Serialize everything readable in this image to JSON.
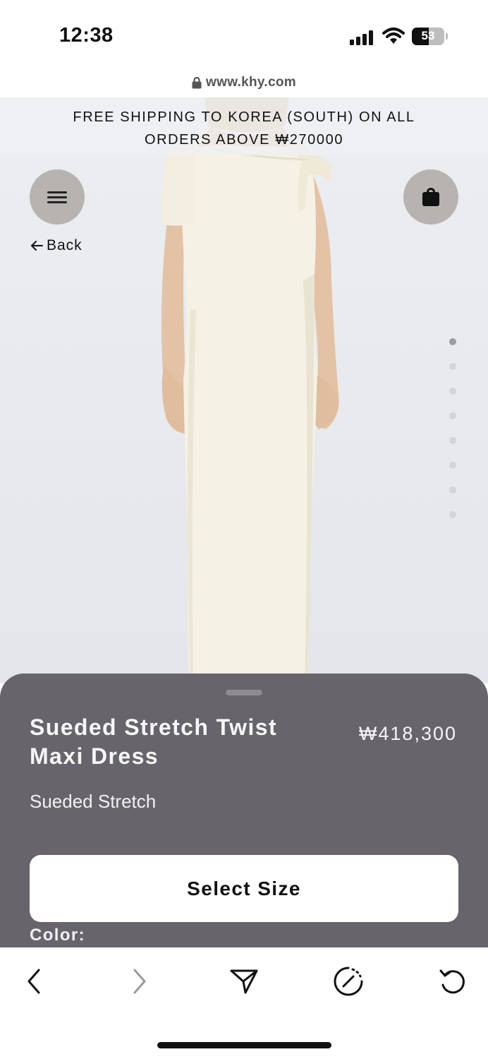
{
  "status_bar": {
    "time": "12:38",
    "battery_level": "53",
    "battery_fraction": 0.53
  },
  "browser": {
    "url": "www.khy.com"
  },
  "promo": {
    "line1": "FREE SHIPPING TO KOREA (SOUTH) ON ALL",
    "line2": "ORDERS ABOVE ₩270000"
  },
  "nav": {
    "back_label": "Back"
  },
  "gallery": {
    "image_count": 8,
    "active_index": 0
  },
  "product": {
    "title_line1": "Sueded Stretch Twist",
    "title_line2": "Maxi Dress",
    "price": "₩418,300",
    "fabric": "Sueded Stretch",
    "select_size_label": "Select Size",
    "color_label": "Color:"
  },
  "icons": {
    "menu": "hamburger-icon",
    "bag": "shopping-bag-icon",
    "back": "arrow-left-icon",
    "lock": "lock-icon",
    "toolbar": [
      "chevron-left-icon",
      "chevron-right-icon",
      "send-icon",
      "speedometer-icon",
      "refresh-icon"
    ]
  },
  "colors": {
    "sheet_background": "#67656b",
    "circle_button": "#b7b3b1",
    "dress": "#f5f1e4"
  }
}
